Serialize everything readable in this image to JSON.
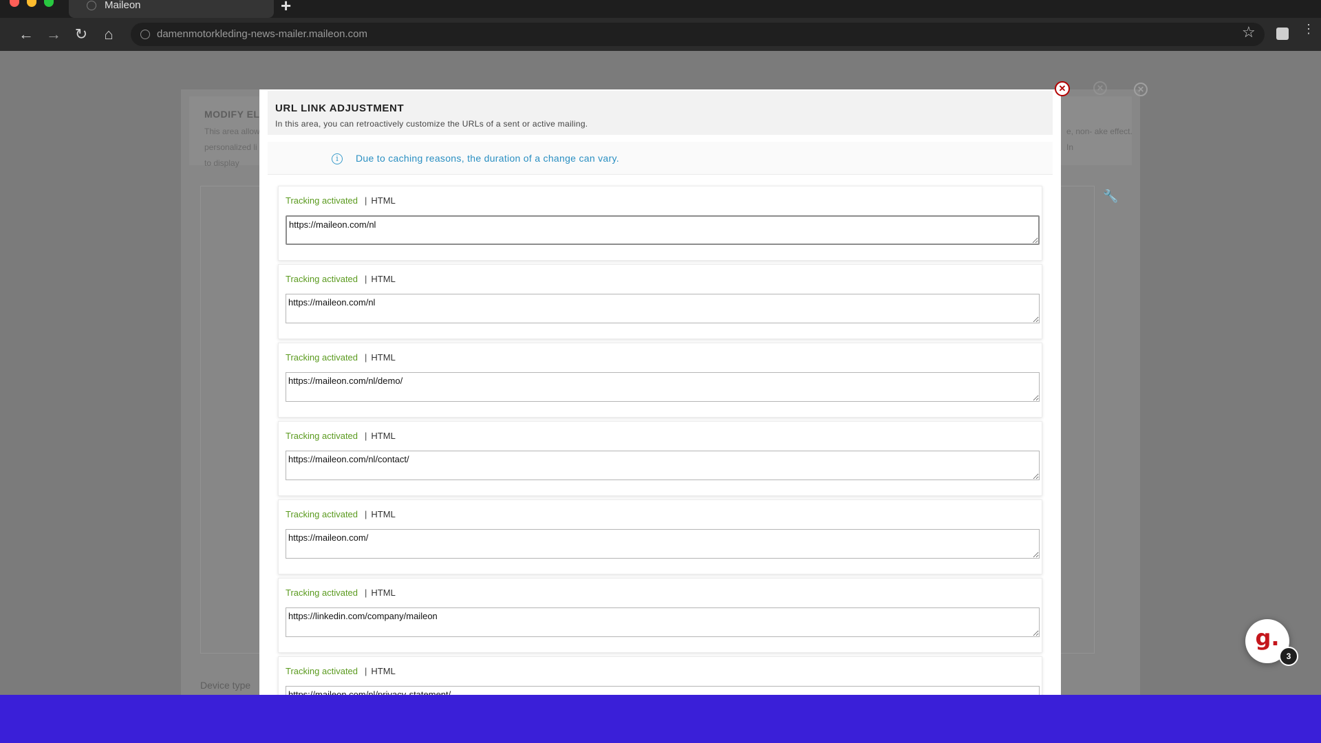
{
  "browser": {
    "tab_title": "Maileon",
    "new_tab_symbol": "+",
    "url": "damenmotorkleding-news-mailer.maileon.com"
  },
  "background_dialog": {
    "title": "MODIFY ELE",
    "desc_left": "This area allow personalized li order to display",
    "desc_right": "e, non- ake effect. In",
    "device_label": "Device type"
  },
  "modal": {
    "title": "URL LINK ADJUSTMENT",
    "subtitle": "In this area, you can retroactively customize the URLs of a sent or active mailing.",
    "notice": "Due to caching reasons, the duration of a change can vary.",
    "links": [
      {
        "tracking": "Tracking activated",
        "separator": "|",
        "format": "HTML",
        "url": "https://maileon.com/nl"
      },
      {
        "tracking": "Tracking activated",
        "separator": "|",
        "format": "HTML",
        "url": "https://maileon.com/nl"
      },
      {
        "tracking": "Tracking activated",
        "separator": "|",
        "format": "HTML",
        "url": "https://maileon.com/nl/demo/"
      },
      {
        "tracking": "Tracking activated",
        "separator": "|",
        "format": "HTML",
        "url": "https://maileon.com/nl/contact/"
      },
      {
        "tracking": "Tracking activated",
        "separator": "|",
        "format": "HTML",
        "url": "https://maileon.com/"
      },
      {
        "tracking": "Tracking activated",
        "separator": "|",
        "format": "HTML",
        "url": "https://linkedin.com/company/maileon"
      },
      {
        "tracking": "Tracking activated",
        "separator": "|",
        "format": "HTML",
        "url": "https://maileon.com/nl/privacy-statement/"
      }
    ]
  },
  "chat_widget": {
    "logo": "g.",
    "badge_count": "3"
  },
  "colors": {
    "tracking_green": "#5a9a1e",
    "notice_blue": "#2a8fc2",
    "close_red": "#b30000",
    "bottom_bar": "#3a1fd8"
  },
  "icons": {
    "back": "arrow-left-icon",
    "forward": "arrow-right-icon",
    "reload": "reload-icon",
    "home": "home-icon",
    "bookmark": "star-icon",
    "extensions": "puzzle-icon",
    "menu": "kebab-menu-icon",
    "close": "close-circle-icon",
    "info": "info-icon",
    "settings": "wrench-icon"
  }
}
